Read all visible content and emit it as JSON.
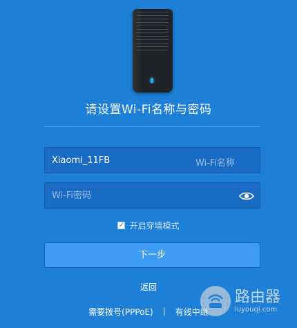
{
  "setup": {
    "title": "请设置Wi-Fi名称与密码",
    "ssid": {
      "value": "Xiaomi_11FB",
      "suffix_label": "Wi-Fi名称"
    },
    "password": {
      "placeholder": "Wi-Fi密码"
    },
    "wall_mode": {
      "label": "开启穿墙模式",
      "checked": true
    },
    "next_label": "下一步",
    "back_label": "返回",
    "bottom_links": {
      "pppoe": "需要拨号(PPPoE)",
      "separator": "|",
      "wired_relay": "有线中继"
    }
  },
  "watermark": {
    "main": "路由器",
    "sub": "luyouqi.com"
  },
  "colors": {
    "background": "#1e7fd6",
    "input_bg": "#1a6bc4",
    "button_bg": "#3d9bf3",
    "led": "#27b6ff"
  }
}
